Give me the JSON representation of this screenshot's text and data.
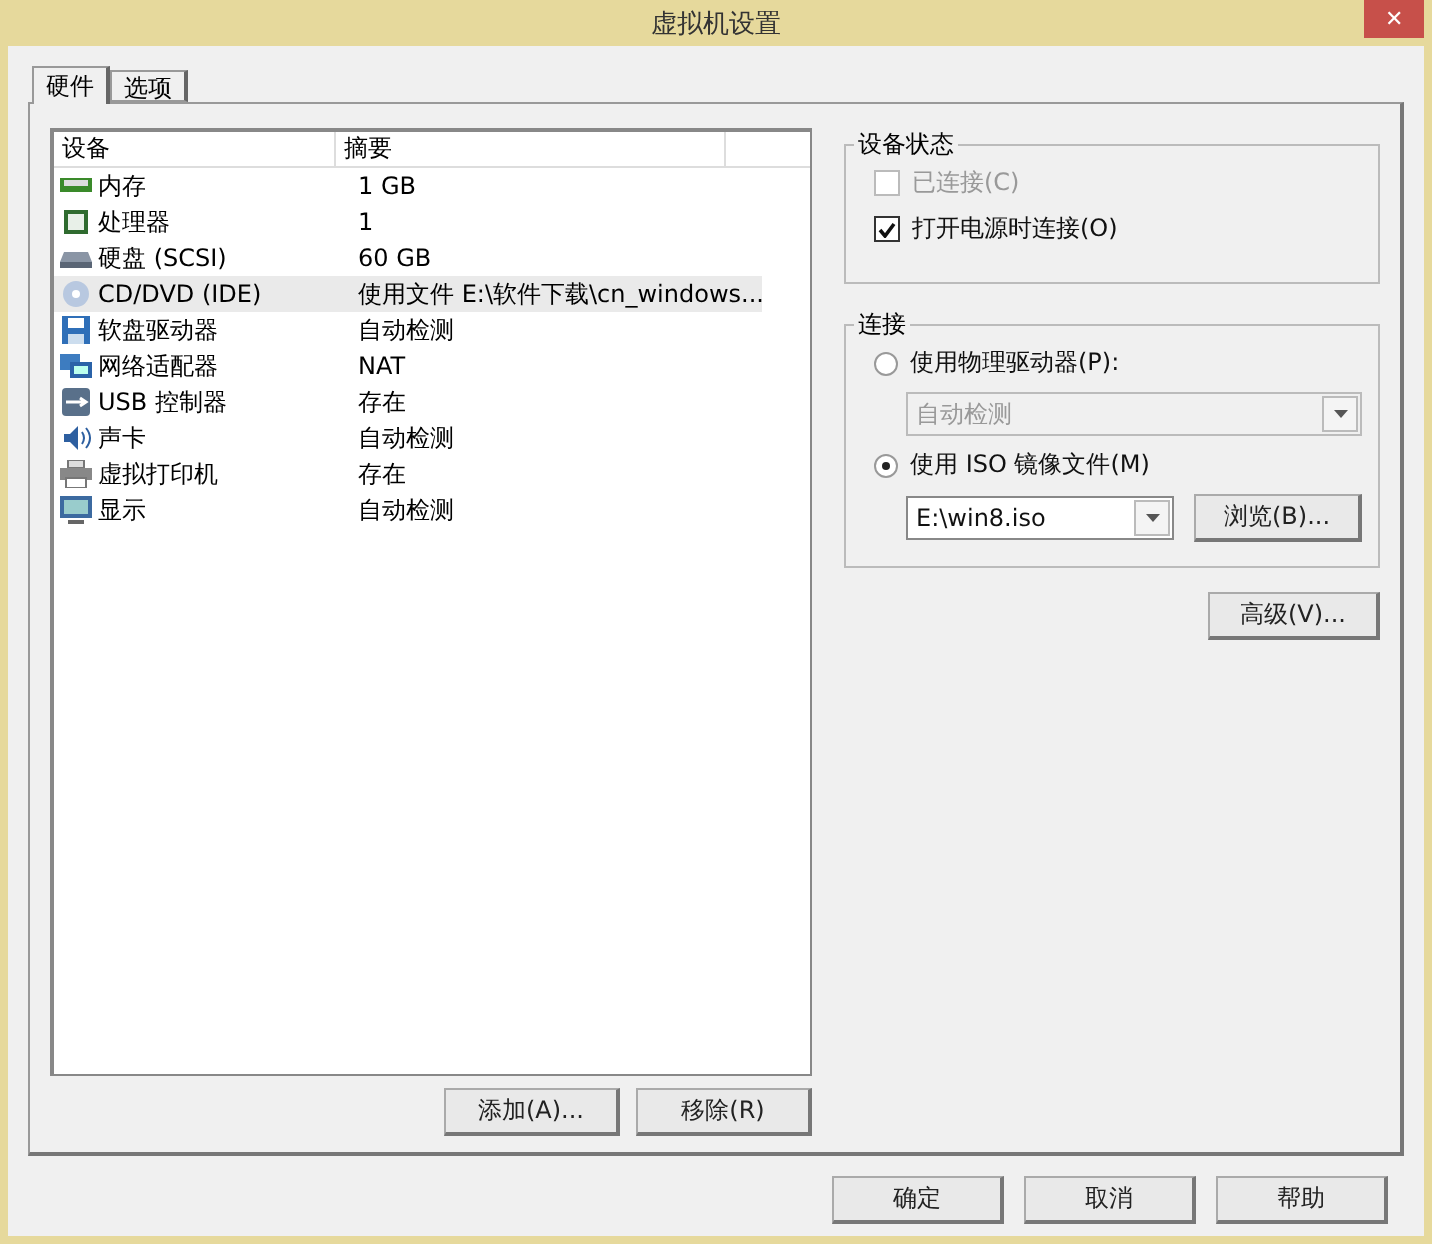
{
  "window": {
    "title": "虚拟机设置",
    "close": "✕"
  },
  "tabs": [
    {
      "label": "硬件",
      "selected": true
    },
    {
      "label": "选项",
      "selected": false
    }
  ],
  "device_table": {
    "columns": [
      "设备",
      "摘要"
    ],
    "rows": [
      {
        "kind": "memory",
        "device": "内存",
        "summary": "1 GB",
        "selected": false
      },
      {
        "kind": "cpu",
        "device": "处理器",
        "summary": "1",
        "selected": false
      },
      {
        "kind": "disk",
        "device": "硬盘 (SCSI)",
        "summary": "60 GB",
        "selected": false
      },
      {
        "kind": "cd",
        "device": "CD/DVD (IDE)",
        "summary": "使用文件 E:\\软件下载\\cn_windows...",
        "selected": true
      },
      {
        "kind": "floppy",
        "device": "软盘驱动器",
        "summary": "自动检测",
        "selected": false
      },
      {
        "kind": "network",
        "device": "网络适配器",
        "summary": "NAT",
        "selected": false
      },
      {
        "kind": "usb",
        "device": "USB 控制器",
        "summary": "存在",
        "selected": false
      },
      {
        "kind": "sound",
        "device": "声卡",
        "summary": "自动检测",
        "selected": false
      },
      {
        "kind": "printer",
        "device": "虚拟打印机",
        "summary": "存在",
        "selected": false
      },
      {
        "kind": "display",
        "device": "显示",
        "summary": "自动检测",
        "selected": false
      }
    ]
  },
  "list_buttons": [
    "添加(A)...",
    "移除(R)"
  ],
  "device_status": {
    "title": "设备状态",
    "options": [
      {
        "label": "已连接(C)",
        "checked": false,
        "disabled": true
      },
      {
        "label": "打开电源时连接(O)",
        "checked": true,
        "disabled": false
      }
    ]
  },
  "connection": {
    "title": "连接",
    "physical": {
      "label": "使用物理驱动器(P):",
      "selected": false,
      "drive": "自动检测",
      "disabled": true
    },
    "iso": {
      "label": "使用 ISO 镜像文件(M)",
      "selected": true,
      "path": "E:\\win8.iso",
      "browse": "浏览(B)..."
    }
  },
  "advanced_button": "高级(V)...",
  "dialog_buttons": [
    "确定",
    "取消",
    "帮助"
  ]
}
